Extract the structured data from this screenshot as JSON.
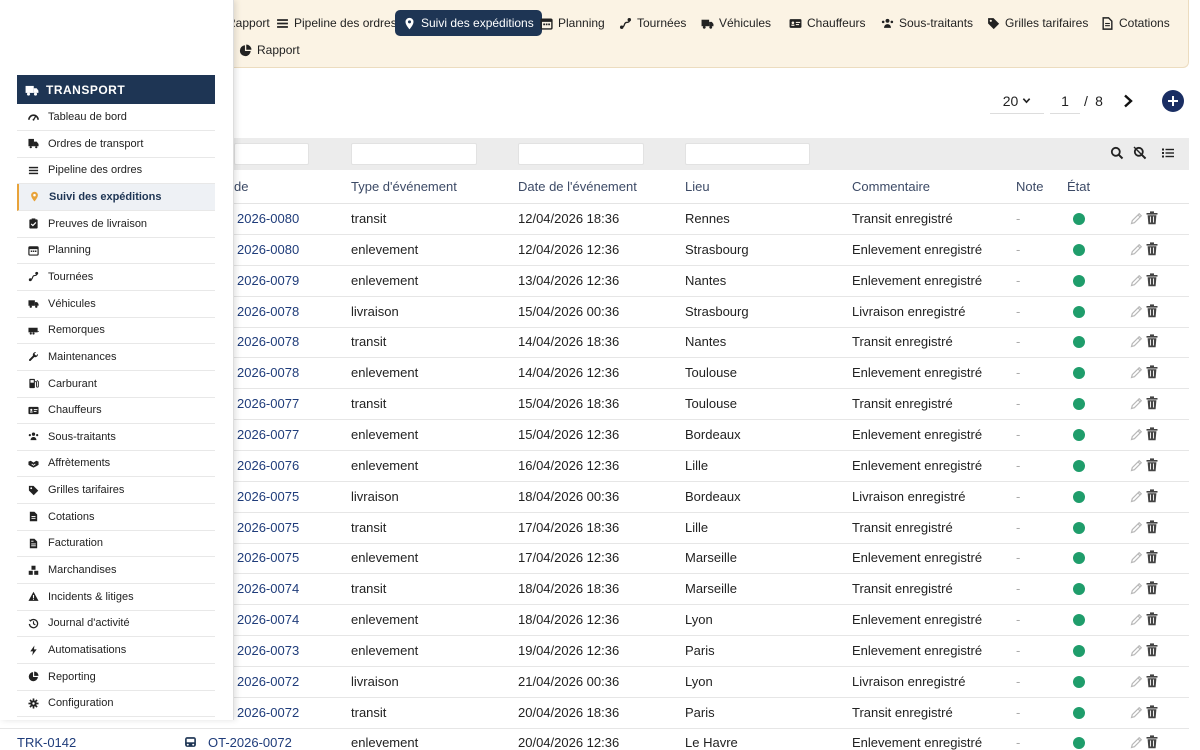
{
  "nav": {
    "items": [
      {
        "label": "Rapport",
        "icon": "report-icon"
      },
      {
        "label": "Pipeline des ordres",
        "icon": "list-icon"
      },
      {
        "label": "Suivi des expéditions",
        "icon": "map-pin-icon"
      },
      {
        "label": "Planning",
        "icon": "calendar-icon"
      },
      {
        "label": "Tournées",
        "icon": "route-icon"
      },
      {
        "label": "Véhicules",
        "icon": "truck-icon"
      },
      {
        "label": "Chauffeurs",
        "icon": "id-card-icon"
      },
      {
        "label": "Sous-traitants",
        "icon": "people-icon"
      },
      {
        "label": "Grilles tarifaires",
        "icon": "tag-icon"
      },
      {
        "label": "Cotations",
        "icon": "document-icon"
      },
      {
        "label": "Rapport",
        "icon": "pie-chart-icon"
      }
    ],
    "active_index": 2
  },
  "pagination": {
    "page_size": "20",
    "current_page": "1",
    "separator": "/",
    "total_pages": "8"
  },
  "table": {
    "columns": {
      "ref": "de",
      "type": "Type d'événement",
      "date": "Date de l'événement",
      "place": "Lieu",
      "comment": "Commentaire",
      "note": "Note",
      "state": "État"
    },
    "rows": [
      {
        "ref": "2026-0080",
        "type": "transit",
        "date": "12/04/2026 18:36",
        "place": "Rennes",
        "comment": "Transit enregistré",
        "note": "-"
      },
      {
        "ref": "2026-0080",
        "type": "enlevement",
        "date": "12/04/2026 12:36",
        "place": "Strasbourg",
        "comment": "Enlevement enregistré",
        "note": "-"
      },
      {
        "ref": "2026-0079",
        "type": "enlevement",
        "date": "13/04/2026 12:36",
        "place": "Nantes",
        "comment": "Enlevement enregistré",
        "note": "-"
      },
      {
        "ref": "2026-0078",
        "type": "livraison",
        "date": "15/04/2026 00:36",
        "place": "Strasbourg",
        "comment": "Livraison enregistré",
        "note": "-"
      },
      {
        "ref": "2026-0078",
        "type": "transit",
        "date": "14/04/2026 18:36",
        "place": "Nantes",
        "comment": "Transit enregistré",
        "note": "-"
      },
      {
        "ref": "2026-0078",
        "type": "enlevement",
        "date": "14/04/2026 12:36",
        "place": "Toulouse",
        "comment": "Enlevement enregistré",
        "note": "-"
      },
      {
        "ref": "2026-0077",
        "type": "transit",
        "date": "15/04/2026 18:36",
        "place": "Toulouse",
        "comment": "Transit enregistré",
        "note": "-"
      },
      {
        "ref": "2026-0077",
        "type": "enlevement",
        "date": "15/04/2026 12:36",
        "place": "Bordeaux",
        "comment": "Enlevement enregistré",
        "note": "-"
      },
      {
        "ref": "2026-0076",
        "type": "enlevement",
        "date": "16/04/2026 12:36",
        "place": "Lille",
        "comment": "Enlevement enregistré",
        "note": "-"
      },
      {
        "ref": "2026-0075",
        "type": "livraison",
        "date": "18/04/2026 00:36",
        "place": "Bordeaux",
        "comment": "Livraison enregistré",
        "note": "-"
      },
      {
        "ref": "2026-0075",
        "type": "transit",
        "date": "17/04/2026 18:36",
        "place": "Lille",
        "comment": "Transit enregistré",
        "note": "-"
      },
      {
        "ref": "2026-0075",
        "type": "enlevement",
        "date": "17/04/2026 12:36",
        "place": "Marseille",
        "comment": "Enlevement enregistré",
        "note": "-"
      },
      {
        "ref": "2026-0074",
        "type": "transit",
        "date": "18/04/2026 18:36",
        "place": "Marseille",
        "comment": "Transit enregistré",
        "note": "-"
      },
      {
        "ref": "2026-0074",
        "type": "enlevement",
        "date": "18/04/2026 12:36",
        "place": "Lyon",
        "comment": "Enlevement enregistré",
        "note": "-"
      },
      {
        "ref": "2026-0073",
        "type": "enlevement",
        "date": "19/04/2026 12:36",
        "place": "Paris",
        "comment": "Enlevement enregistré",
        "note": "-"
      },
      {
        "ref": "2026-0072",
        "type": "livraison",
        "date": "21/04/2026 00:36",
        "place": "Lyon",
        "comment": "Livraison enregistré",
        "note": "-"
      },
      {
        "ref": "2026-0072",
        "type": "transit",
        "date": "20/04/2026 18:36",
        "place": "Paris",
        "comment": "Transit enregistré",
        "note": "-"
      },
      {
        "ref": "OT-2026-0072",
        "type": "enlevement",
        "date": "20/04/2026 12:36",
        "place": "Le Havre",
        "comment": "Enlevement enregistré",
        "note": "-",
        "tracking": "TRK-0142"
      }
    ],
    "state_color": "#1f9d6b"
  },
  "sidebar": {
    "title": "TRANSPORT",
    "items": [
      {
        "label": "Tableau de bord",
        "icon": "dashboard-icon"
      },
      {
        "label": "Ordres de transport",
        "icon": "transport-order-icon"
      },
      {
        "label": "Pipeline des ordres",
        "icon": "list-icon"
      },
      {
        "label": "Suivi des expéditions",
        "icon": "map-pin-icon"
      },
      {
        "label": "Preuves de livraison",
        "icon": "clipboard-check-icon"
      },
      {
        "label": "Planning",
        "icon": "calendar-icon"
      },
      {
        "label": "Tournées",
        "icon": "route-icon"
      },
      {
        "label": "Véhicules",
        "icon": "truck-icon"
      },
      {
        "label": "Remorques",
        "icon": "trailer-icon"
      },
      {
        "label": "Maintenances",
        "icon": "wrench-icon"
      },
      {
        "label": "Carburant",
        "icon": "fuel-icon"
      },
      {
        "label": "Chauffeurs",
        "icon": "id-card-icon"
      },
      {
        "label": "Sous-traitants",
        "icon": "people-icon"
      },
      {
        "label": "Affrètements",
        "icon": "handshake-icon"
      },
      {
        "label": "Grilles tarifaires",
        "icon": "tag-icon"
      },
      {
        "label": "Cotations",
        "icon": "document-icon"
      },
      {
        "label": "Facturation",
        "icon": "invoice-icon"
      },
      {
        "label": "Marchandises",
        "icon": "boxes-icon"
      },
      {
        "label": "Incidents & litiges",
        "icon": "warning-icon"
      },
      {
        "label": "Journal d'activité",
        "icon": "history-icon"
      },
      {
        "label": "Automatisations",
        "icon": "bolt-icon"
      },
      {
        "label": "Reporting",
        "icon": "pie-chart-icon"
      },
      {
        "label": "Configuration",
        "icon": "gear-icon"
      }
    ],
    "active_index": 3
  },
  "colors": {
    "navy": "#1e3554",
    "accent": "#e8a33a",
    "nav_bg": "#fbf3e4"
  }
}
